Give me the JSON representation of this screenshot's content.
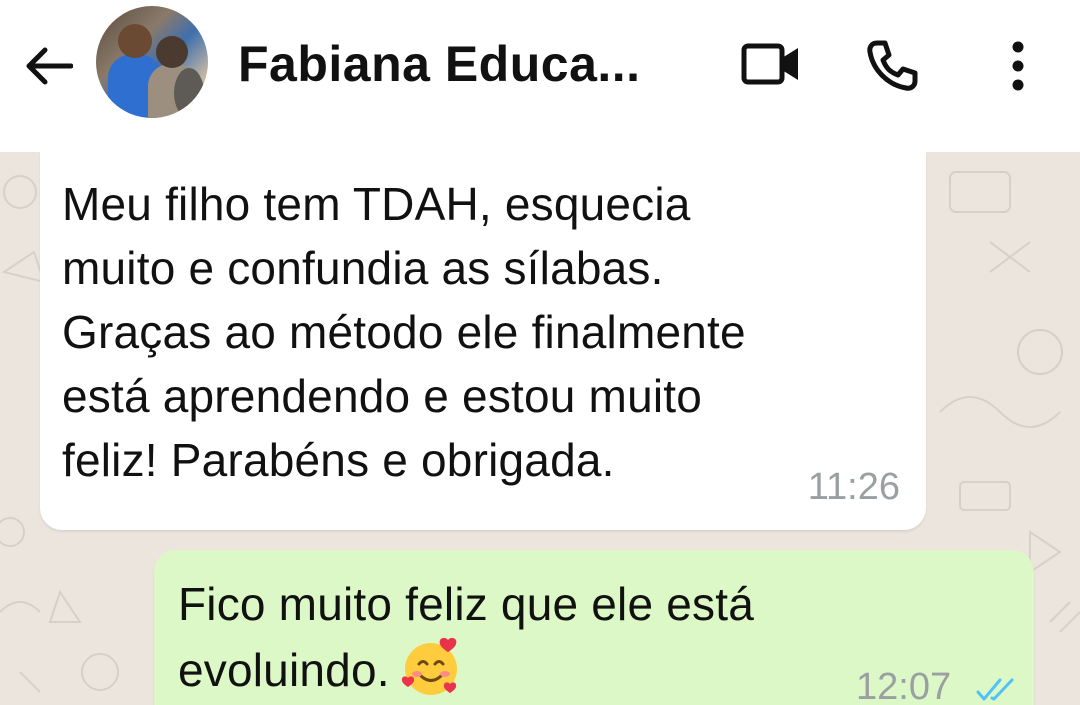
{
  "header": {
    "contact_name": "Fabiana Educa...",
    "icons": {
      "back": "arrow-left-icon",
      "video": "video-camera-icon",
      "call": "phone-icon",
      "menu": "more-vertical-icon"
    }
  },
  "messages": [
    {
      "direction": "incoming",
      "text": "Meu filho tem TDAH, esquecia\nmuito e confundia as sílabas.\nGraças ao método ele finalmente\nestá aprendendo e estou muito\nfeliz! Parabéns e obrigada.",
      "time": "11:26"
    },
    {
      "direction": "outgoing",
      "text": "Fico muito feliz que ele está\nevoluindo.",
      "emoji": "smiling-face-with-hearts-icon",
      "time": "12:07",
      "status": "double-check-icon"
    }
  ],
  "colors": {
    "chat_background": "#ece5dd",
    "incoming_bubble": "#ffffff",
    "outgoing_bubble": "#dcf8c6",
    "read_ticks": "#4fc3f7"
  }
}
